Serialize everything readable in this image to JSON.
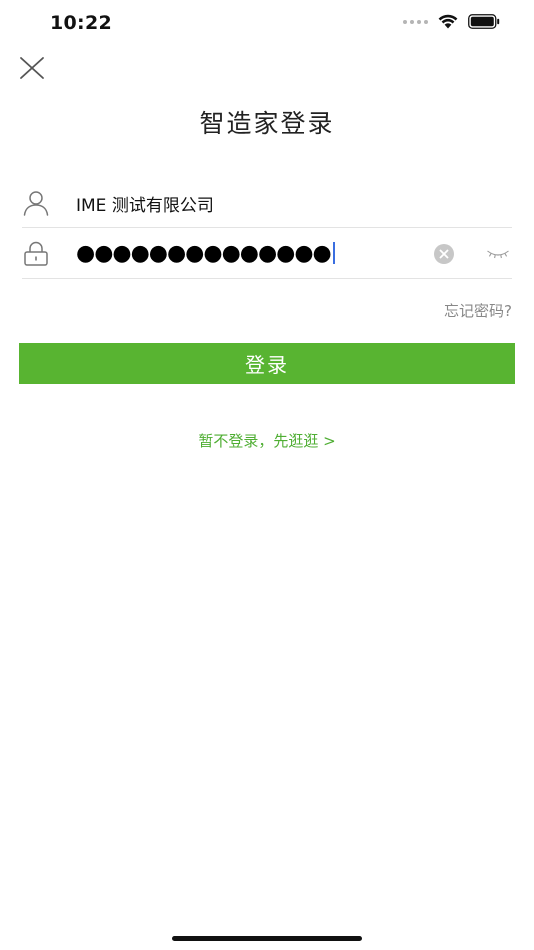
{
  "status_bar": {
    "time": "10:22"
  },
  "header": {
    "title": "智造家登录"
  },
  "form": {
    "username": {
      "value": "IME 测试有限公司",
      "icon": "user-icon"
    },
    "password": {
      "masked_value": "●●●●●●●●●●●●●●",
      "icon": "lock-icon"
    },
    "forgot_label": "忘记密码?",
    "login_label": "登录",
    "guest_label": "暂不登录，先逛逛 >"
  },
  "colors": {
    "accent": "#58b431",
    "link_green": "#4fae33",
    "muted_text": "#888888",
    "divider": "#e3e3e3"
  }
}
